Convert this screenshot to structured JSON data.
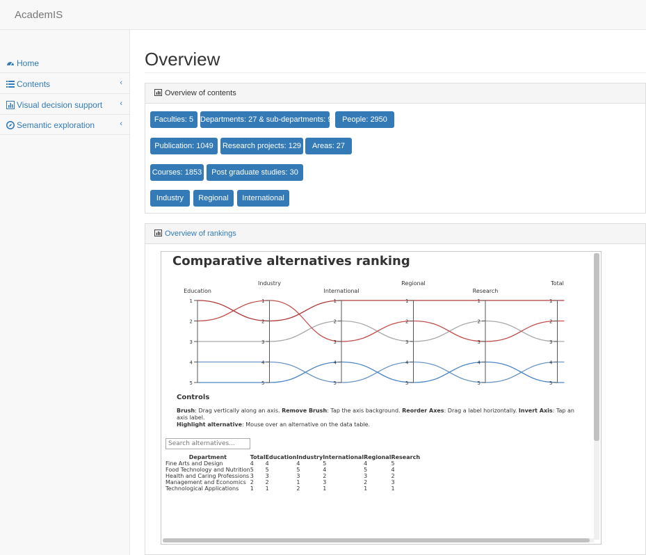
{
  "app": {
    "brand": "AcademIS"
  },
  "sidebar": {
    "items": [
      {
        "label": "Home",
        "icon": "dashboard-icon",
        "chevron": ""
      },
      {
        "label": "Contents",
        "icon": "list-icon",
        "chevron": "‹"
      },
      {
        "label": "Visual decision support",
        "icon": "chart-icon",
        "chevron": "‹"
      },
      {
        "label": "Semantic exploration",
        "icon": "compass-icon",
        "chevron": "‹"
      }
    ]
  },
  "main": {
    "title": "Overview",
    "contents_panel": {
      "header": "Overview of contents",
      "rows": [
        [
          "Faculties: 5",
          "Departments: 27 & sub-departments: 9",
          "People: 2950"
        ],
        [
          "Publication: 1049",
          "Research projects: 129",
          "Areas: 27"
        ],
        [
          "Courses: 1853",
          "Post graduate studies: 30"
        ],
        [
          "Industry",
          "Regional",
          "International"
        ]
      ]
    },
    "rankings_panel": {
      "header": "Overview of rankings",
      "title": "Comparative alternatives ranking",
      "controls": {
        "heading": "Controls",
        "brush_label": "Brush",
        "brush_text": ": Drag vertically along an axis. ",
        "remove_label": "Remove Brush",
        "remove_text": ": Tap the axis background. ",
        "reorder_label": "Reorder Axes",
        "reorder_text": ": Drag a label horizontally. ",
        "invert_label": "Invert Axis",
        "invert_text": ": Tap an axis label.",
        "highlight_label": "Highlight alternative",
        "highlight_text": ": Mouse over an alternative on the data table."
      },
      "search_placeholder": "Search alternatives...",
      "table": {
        "headers": [
          "Department",
          "Total",
          "Education",
          "Industry",
          "International",
          "Regional",
          "Research"
        ],
        "rows": [
          [
            "Fine Arts and Design",
            "4",
            "4",
            "4",
            "5",
            "4",
            "5"
          ],
          [
            "Food Technology and Nutrition",
            "5",
            "5",
            "5",
            "4",
            "5",
            "4"
          ],
          [
            "Health and Caring Professions",
            "3",
            "3",
            "3",
            "2",
            "3",
            "2"
          ],
          [
            "Management and Economics",
            "2",
            "2",
            "1",
            "3",
            "2",
            "3"
          ],
          [
            "Technological Applications",
            "1",
            "1",
            "2",
            "1",
            "1",
            "1"
          ]
        ]
      }
    }
  },
  "chart_data": {
    "type": "parallel-coordinates",
    "title": "Comparative alternatives ranking",
    "axes": [
      "Education",
      "Industry",
      "International",
      "Regional",
      "Research",
      "Total"
    ],
    "ticks": [
      1,
      2,
      3,
      4,
      5
    ],
    "series": [
      {
        "name": "Fine Arts and Design",
        "values": [
          4,
          4,
          5,
          4,
          5,
          4
        ],
        "color": "#6d96c8"
      },
      {
        "name": "Food Technology and Nutrition",
        "values": [
          5,
          5,
          4,
          5,
          4,
          5
        ],
        "color": "#4b86c5"
      },
      {
        "name": "Health and Caring Professions",
        "values": [
          3,
          3,
          2,
          3,
          2,
          3
        ],
        "color": "#a9a9a9"
      },
      {
        "name": "Management and Economics",
        "values": [
          2,
          1,
          3,
          2,
          3,
          2
        ],
        "color": "#c0504d"
      },
      {
        "name": "Technological Applications",
        "values": [
          1,
          2,
          1,
          1,
          1,
          1
        ],
        "color": "#b03a3a"
      }
    ]
  }
}
